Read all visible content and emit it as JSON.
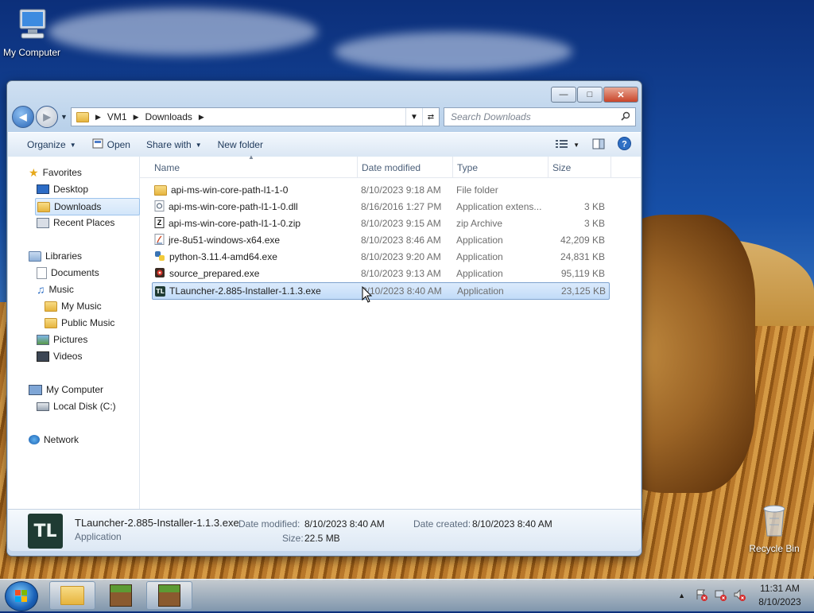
{
  "desktop": {
    "icons": [
      {
        "label": "My Computer",
        "icon": "computer-icon"
      },
      {
        "label": "Recycle Bin",
        "icon": "recycle-bin-icon"
      }
    ]
  },
  "window": {
    "controls": {
      "minimize": "minimize-icon",
      "maximize": "maximize-icon",
      "close": "close-icon"
    },
    "address": {
      "segments": [
        "VM1",
        "Downloads"
      ]
    },
    "search": {
      "placeholder": "Search Downloads"
    },
    "toolbar": {
      "organize": "Organize",
      "open": "Open",
      "share_with": "Share with",
      "new_folder": "New folder"
    },
    "nav": {
      "favorites": "Favorites",
      "desktop": "Desktop",
      "downloads": "Downloads",
      "recent_places": "Recent Places",
      "libraries": "Libraries",
      "documents": "Documents",
      "music": "Music",
      "my_music": "My Music",
      "public_music": "Public Music",
      "pictures": "Pictures",
      "videos": "Videos",
      "my_computer": "My Computer",
      "local_disk": "Local Disk (C:)",
      "network": "Network"
    },
    "columns": {
      "name": "Name",
      "date": "Date modified",
      "type": "Type",
      "size": "Size"
    },
    "files": [
      {
        "name": "api-ms-win-core-path-l1-1-0",
        "date": "8/10/2023 9:18 AM",
        "type": "File folder",
        "size": "",
        "icon": "folder-icon"
      },
      {
        "name": "api-ms-win-core-path-l1-1-0.dll",
        "date": "8/16/2016 1:27 PM",
        "type": "Application extens...",
        "size": "3 KB",
        "icon": "dll-icon"
      },
      {
        "name": "api-ms-win-core-path-l1-1-0.zip",
        "date": "8/10/2023 9:15 AM",
        "type": "zip Archive",
        "size": "3 KB",
        "icon": "zip-icon"
      },
      {
        "name": "jre-8u51-windows-x64.exe",
        "date": "8/10/2023 8:46 AM",
        "type": "Application",
        "size": "42,209 KB",
        "icon": "java-icon"
      },
      {
        "name": "python-3.11.4-amd64.exe",
        "date": "8/10/2023 9:20 AM",
        "type": "Application",
        "size": "24,831 KB",
        "icon": "python-icon"
      },
      {
        "name": "source_prepared.exe",
        "date": "8/10/2023 9:13 AM",
        "type": "Application",
        "size": "95,119 KB",
        "icon": "app-icon"
      },
      {
        "name": "TLauncher-2.885-Installer-1.1.3.exe",
        "date": "8/10/2023 8:40 AM",
        "type": "Application",
        "size": "23,125 KB",
        "icon": "tlauncher-icon"
      }
    ],
    "details": {
      "name": "TLauncher-2.885-Installer-1.1.3.exe",
      "kind": "Application",
      "modified_label": "Date modified:",
      "modified": "8/10/2023 8:40 AM",
      "created_label": "Date created:",
      "created": "8/10/2023 8:40 AM",
      "size_label": "Size:",
      "size": "22.5 MB"
    }
  },
  "taskbar": {
    "clock_time": "11:31 AM",
    "clock_date": "8/10/2023"
  }
}
